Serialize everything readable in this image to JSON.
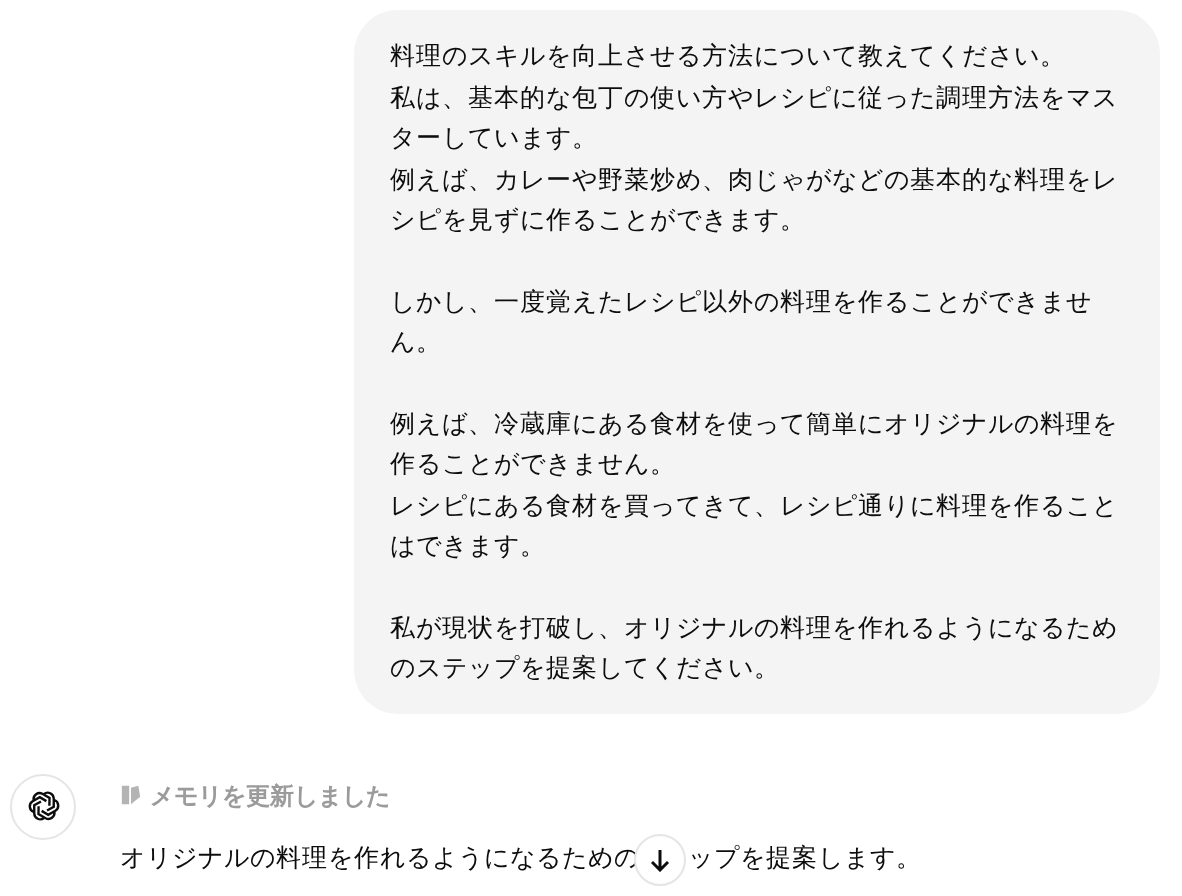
{
  "user_message": {
    "paragraphs": [
      [
        "料理のスキルを向上させる方法について教えてください。",
        "私は、基本的な包丁の使い方やレシピに従った調理方法をマスターしています。",
        "例えば、カレーや野菜炒め、肉じゃがなどの基本的な料理をレシピを見ずに作ることができます。"
      ],
      [
        "しかし、一度覚えたレシピ以外の料理を作ることができません。"
      ],
      [
        "例えば、冷蔵庫にある食材を使って簡単にオリジナルの料理を作ることができません。",
        "レシピにある食材を買ってきて、レシピ通りに料理を作ることはできます。"
      ],
      [
        "私が現状を打破し、オリジナルの料理を作れるようになるためのステップを提案してください。"
      ]
    ]
  },
  "assistant_message": {
    "memory_status": "メモリを更新しました",
    "text_before": "オリジナルの料理を作れるようになるための",
    "text_after": "ップを提案します。"
  }
}
